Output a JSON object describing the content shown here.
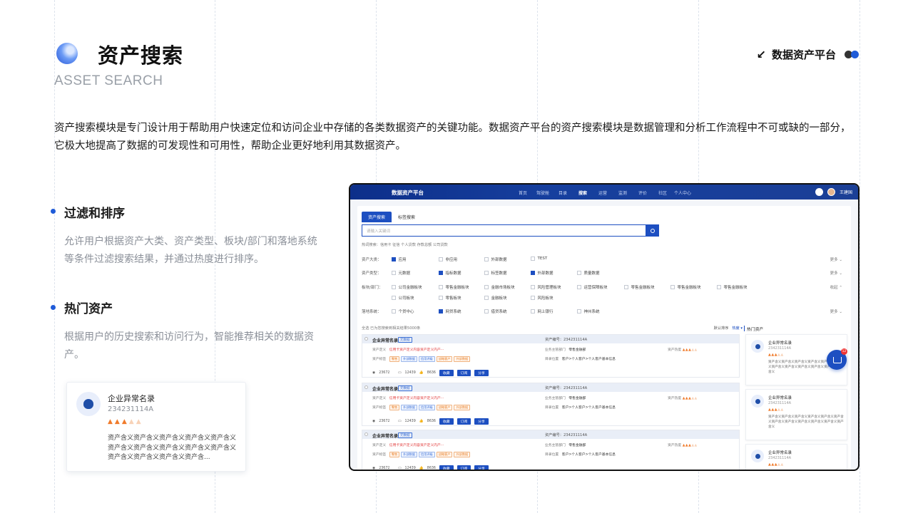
{
  "header": {
    "title": "资产搜索",
    "subtitle": "ASSET SEARCH",
    "brand_arrow": "↙",
    "brand_label": "数据资产平台"
  },
  "description": "资产搜索模块是专门设计用于帮助用户快速定位和访问企业中存储的各类数据资产的关键功能。数据资产平台的资产搜索模块是数据管理和分析工作流程中不可或缺的一部分，它极大地提高了数据的可发现性和可用性，帮助企业更好地利用其数据资产。",
  "features": [
    {
      "title": "过滤和排序",
      "text": "允许用户根据资产大类、资产类型、板块/部门和落地系统等条件过滤搜索结果，并通过热度进行排序。"
    },
    {
      "title": "热门资产",
      "text": "根据用户的历史搜索和访问行为，智能推荐相关的数据资产。"
    }
  ],
  "mini_card": {
    "name": "企业异常名录",
    "code": "234231114A",
    "heat_level": 3,
    "heat_max": 5,
    "desc": "资产含义资产含义资产含义资产含义资产含义资产含义资产含义资产含义资产含义资产含义资产含义资产含义资产含义资产含..."
  },
  "mock": {
    "app_title": "数据资产平台",
    "nav": [
      "首页",
      "驾驶舱",
      "目录",
      "搜索",
      "运营",
      "监测",
      "评价",
      "社区",
      "个人中心"
    ],
    "nav_active": "搜索",
    "user": "王建国",
    "tabs": [
      "资产搜索",
      "标签搜索"
    ],
    "search_placeholder": "请输入关键词",
    "hot_search": "热词搜索：信用卡  征信  个人贷款  存款总额  公司贷款",
    "filters": [
      {
        "label": "资产大类：",
        "options": [
          {
            "t": "应用",
            "on": true
          },
          {
            "t": "非应用",
            "on": false
          },
          {
            "t": "外部数据",
            "on": false
          },
          {
            "t": "TEST",
            "on": false
          }
        ],
        "more": "更多 ⌄"
      },
      {
        "label": "资产类型：",
        "options": [
          {
            "t": "元数据",
            "on": false
          },
          {
            "t": "指标数据",
            "on": true
          },
          {
            "t": "标签数据",
            "on": false
          },
          {
            "t": "外部数据",
            "on": true
          },
          {
            "t": "质量数据",
            "on": false
          }
        ],
        "more": "更多 ⌄"
      },
      {
        "label": "板块/部门：",
        "options": [
          {
            "t": "公司金融板块",
            "on": false
          },
          {
            "t": "零售金融板块",
            "on": false
          },
          {
            "t": "金融市场板块",
            "on": false
          },
          {
            "t": "风险管理板块",
            "on": false
          },
          {
            "t": "运营保障板块",
            "on": false
          },
          {
            "t": "零售金融板块",
            "on": false
          },
          {
            "t": "零售金融板块",
            "on": false
          },
          {
            "t": "零售金融板块",
            "on": false
          }
        ],
        "more": "收起 ⌃"
      },
      {
        "label": "",
        "options": [
          {
            "t": "公司板块",
            "on": false
          },
          {
            "t": "零售板块",
            "on": false
          },
          {
            "t": "金融板块",
            "on": false
          },
          {
            "t": "风险板块",
            "on": false
          }
        ],
        "more": ""
      },
      {
        "label": "落地系统：",
        "options": [
          {
            "t": "个贷中心",
            "on": false
          },
          {
            "t": "网贷系统",
            "on": true
          },
          {
            "t": "借贷系统",
            "on": false
          },
          {
            "t": "网上银行",
            "on": false
          },
          {
            "t": "神州系统",
            "on": false
          }
        ],
        "more": "更多 ⌄"
      }
    ],
    "list_head": "全选    已为您搜索到相关结果5000条",
    "sort": {
      "default": "默认排序",
      "hot": "热度 ▾"
    },
    "side_title": "热门资产",
    "items": [
      {
        "name": "企业异常名录",
        "tag": "元数据",
        "code": "资产编号：234231114A",
        "def_label": "资产定义",
        "def": "信用卡资产定义内容资产定义内产···",
        "owner": "业务主管部门",
        "owner_v": "零售金融部",
        "heat": "资产热度",
        "tags_label": "资产标签",
        "tags": [
          "零售",
          "外部数据",
          "信用评级",
          "战略客户",
          "外部数据"
        ],
        "sys": "目录位置",
        "sys_v": "客户>个人客户>个人客户基本信息",
        "views": "23672",
        "comments": "12439",
        "likes": "8636",
        "b1": "收藏",
        "b2": "订阅",
        "b3": "分享"
      },
      {
        "name": "企业异常名录",
        "tag": "元数据",
        "code": "资产编号：234231114A",
        "def_label": "资产定义",
        "def": "信用卡资产定义内容资产定义内产···",
        "owner": "业务主管部门",
        "owner_v": "零售金融部",
        "heat": "资产热度",
        "tags_label": "资产标签",
        "tags": [
          "零售",
          "外部数据",
          "信用评级",
          "战略客户",
          "外部数据"
        ],
        "sys": "目录位置",
        "sys_v": "客户>个人客户>个人客户基本信息",
        "views": "23672",
        "comments": "12439",
        "likes": "8636",
        "b1": "收藏",
        "b2": "订阅",
        "b3": "分享"
      },
      {
        "name": "企业异常名录",
        "tag": "元数据",
        "code": "资产编号：234231114A",
        "def_label": "资产定义",
        "def": "信用卡资产定义内容资产定义内产···",
        "owner": "业务主管部门",
        "owner_v": "零售金融部",
        "heat": "资产热度",
        "tags_label": "资产标签",
        "tags": [
          "零售",
          "外部数据",
          "信用评级",
          "战略客户",
          "外部数据"
        ],
        "sys": "目录位置",
        "sys_v": "客户>个人客户>个人客户基本信息",
        "views": "23672",
        "comments": "12439",
        "likes": "8636",
        "b1": "收藏",
        "b2": "订阅",
        "b3": "分享"
      }
    ],
    "side_cards": [
      {
        "name": "企业异常名录",
        "code": "234231114A",
        "desc": "资产含义资产含义资产含义资产含义资产含义资产含义资产含义资产含义资产含义资产含义资产含义资产含义"
      },
      {
        "name": "企业异常名录",
        "code": "234231114A",
        "desc": "资产含义资产含义资产含义资产含义资产含义资产含义资产含义资产含义资产含义资产含义资产含义资产含义"
      },
      {
        "name": "企业异常名录",
        "code": "234231114A",
        "desc": ""
      }
    ],
    "cart_badge": "12"
  },
  "colors": {
    "accent": "#1f5bd8",
    "nav_bg": "#0d2f8a",
    "heat": "#f07b2b"
  }
}
